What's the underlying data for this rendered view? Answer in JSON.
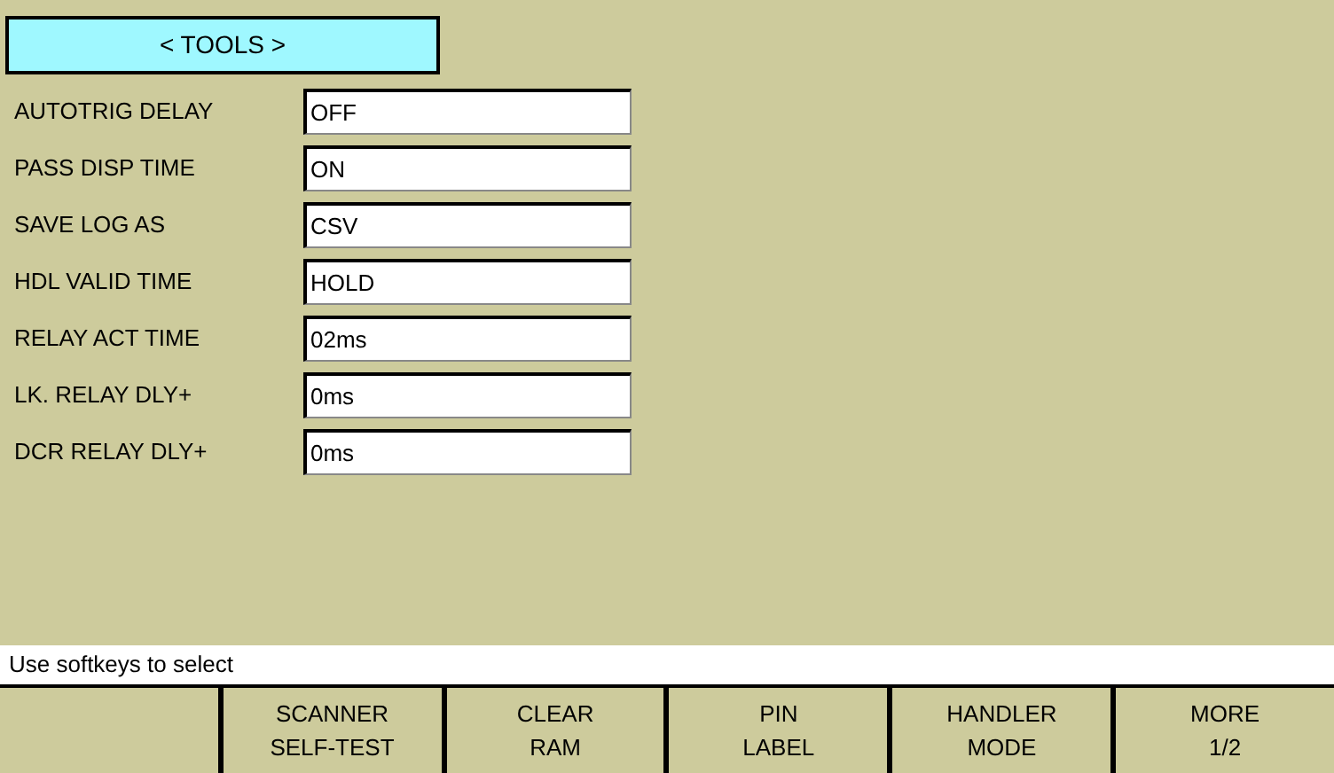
{
  "title": "< TOOLS >",
  "settings": [
    {
      "label": "AUTOTRIG DELAY",
      "value": "OFF"
    },
    {
      "label": "PASS DISP TIME",
      "value": "ON"
    },
    {
      "label": "SAVE LOG AS",
      "value": "CSV"
    },
    {
      "label": "HDL VALID TIME",
      "value": "HOLD"
    },
    {
      "label": "RELAY ACT TIME",
      "value": "02ms"
    },
    {
      "label": "LK. RELAY DLY+",
      "value": "0ms"
    },
    {
      "label": "DCR RELAY DLY+",
      "value": "0ms"
    }
  ],
  "status_bar": "Use softkeys to select",
  "softkeys": [
    {
      "lines": [
        "SCANNER",
        "SELF-TEST"
      ]
    },
    {
      "lines": [
        "CLEAR",
        "RAM"
      ]
    },
    {
      "lines": [
        "PIN",
        "LABEL"
      ]
    },
    {
      "lines": [
        "HANDLER",
        "MODE"
      ]
    },
    {
      "lines": [
        "MORE",
        "1/2"
      ]
    }
  ]
}
